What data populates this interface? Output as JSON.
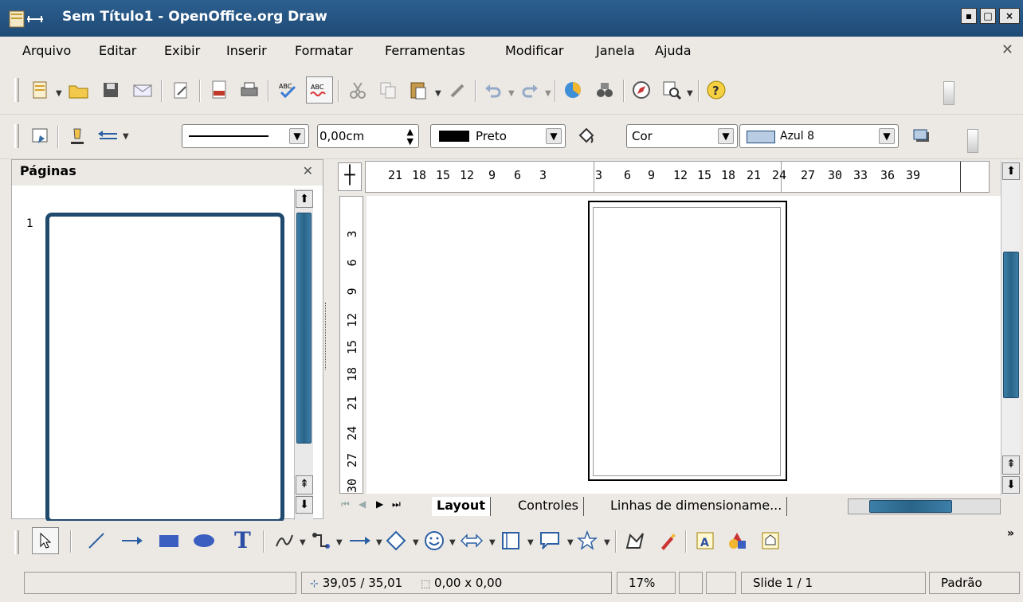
{
  "window": {
    "title": "Sem Título1 - OpenOffice.org Draw"
  },
  "menu": [
    "Arquivo",
    "Editar",
    "Exibir",
    "Inserir",
    "Formatar",
    "Ferramentas",
    "Modificar",
    "Janela",
    "Ajuda"
  ],
  "line_props": {
    "width_value": "0,00cm",
    "line_color": "Preto",
    "fill_type": "Cor",
    "fill_color": "Azul 8",
    "line_swatch": "#000000",
    "fill_swatch": "#b8cce4"
  },
  "pages_panel": {
    "title": "Páginas",
    "pages": [
      {
        "number": "1"
      }
    ]
  },
  "rulers": {
    "horizontal": [
      "21",
      "18",
      "15",
      "12",
      "9",
      "6",
      "3",
      "3",
      "6",
      "9",
      "12",
      "15",
      "18",
      "21",
      "24",
      "27",
      "30",
      "33",
      "36",
      "39"
    ],
    "vertical": [
      "3",
      "6",
      "9",
      "12",
      "15",
      "18",
      "21",
      "24",
      "27",
      "30"
    ]
  },
  "tabs": [
    "Layout",
    "Controles",
    "Linhas de dimensioname..."
  ],
  "status": {
    "position": "39,05 / 35,01",
    "size": "0,00 x 0,00",
    "zoom": "17%",
    "slide": "Slide 1 / 1",
    "style": "Padrão"
  },
  "colors": {
    "titlebar": "#1f4a76",
    "accent": "#2a6488"
  }
}
